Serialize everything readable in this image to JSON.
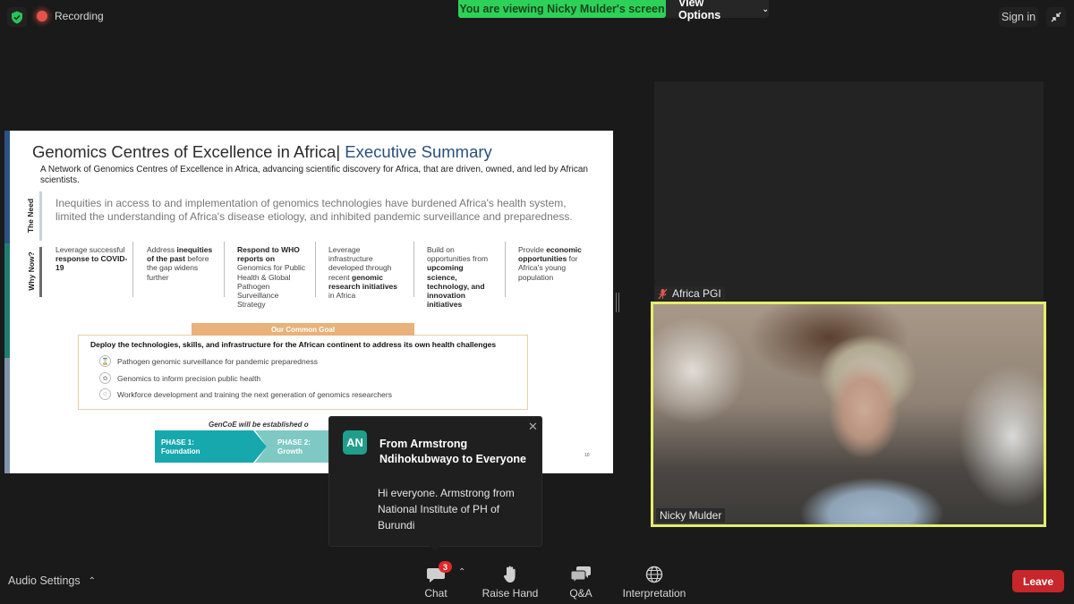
{
  "topbar": {
    "security_icon": "shield-check-icon",
    "recording_label": "Recording",
    "viewing_banner": "You are viewing Nicky Mulder's screen",
    "view_options_label": "View Options",
    "sign_in_label": "Sign in",
    "exit_fullscreen_icon": "exit-fullscreen-icon"
  },
  "slide": {
    "title_main": "Genomics Centres of Excellence in Africa",
    "title_separator": "| ",
    "title_sub": "Executive Summary",
    "intro": "A Network of Genomics Centres of Excellence in Africa, advancing scientific discovery for Africa, that are driven, owned, and led by African scientists.",
    "need_label": "The Need",
    "need_text": "Inequities in access to and implementation of genomics technologies have burdened Africa's health system, limited the understanding of Africa's disease etiology, and inhibited pandemic surveillance and preparedness.",
    "why_label": "Why Now?",
    "why_columns": [
      {
        "pre": "Leverage successful ",
        "bold": "response to COVID-19",
        "post": ""
      },
      {
        "pre": "Address ",
        "bold": "inequities of the past",
        "post": " before the gap widens further"
      },
      {
        "pre": "",
        "bold": "Respond to WHO reports on",
        "post": " Genomics for Public Health & Global Pathogen Surveillance Strategy"
      },
      {
        "pre": "Leverage infrastructure developed through recent ",
        "bold": "genomic research initiatives",
        "post": " in Africa"
      },
      {
        "pre": "Build on opportunities from ",
        "bold": "upcoming science, technology, and innovation initiatives",
        "post": ""
      },
      {
        "pre": "Provide ",
        "bold": "economic opportunities",
        "post": " for Africa's young population"
      }
    ],
    "goal_header": "Our Common Goal",
    "goal_main": "Deploy the technologies, skills, and infrastructure for the African continent to address its own health challenges",
    "goal_items": [
      {
        "icon": "hourglass-icon",
        "text": "Pathogen genomic surveillance for pandemic preparedness"
      },
      {
        "icon": "dna-icon",
        "text": "Genomics to inform precision public health"
      },
      {
        "icon": "training-icon",
        "text": "Workforce development and training the next generation of genomics researchers"
      }
    ],
    "gencoe_note": "GenCoE will be established o",
    "phases": [
      {
        "line1": "PHASE 1:",
        "line2": "Foundation"
      },
      {
        "line1": "PHASE 2:",
        "line2": "Growth"
      }
    ],
    "page_number": "10",
    "colors": {
      "blue": "#2a5284",
      "teal": "#1f7d72",
      "phase1": "#17a8ad",
      "goal": "#e8b27a"
    }
  },
  "participants": [
    {
      "name": "Africa PGI",
      "muted": true,
      "video": false
    },
    {
      "name": "Nicky Mulder",
      "muted": false,
      "video": true,
      "active_speaker": true
    }
  ],
  "chat_popup": {
    "avatar_initials": "AN",
    "from": "From Armstrong Ndihokubwayo to Everyone",
    "message": "Hi everyone. Armstrong from National Institute of PH of Burundi",
    "close_icon": "close-icon"
  },
  "toolbar": {
    "audio_settings_label": "Audio Settings",
    "chat_label": "Chat",
    "chat_badge": "3",
    "raise_hand_label": "Raise Hand",
    "qa_label": "Q&A",
    "interpretation_label": "Interpretation",
    "leave_label": "Leave"
  }
}
